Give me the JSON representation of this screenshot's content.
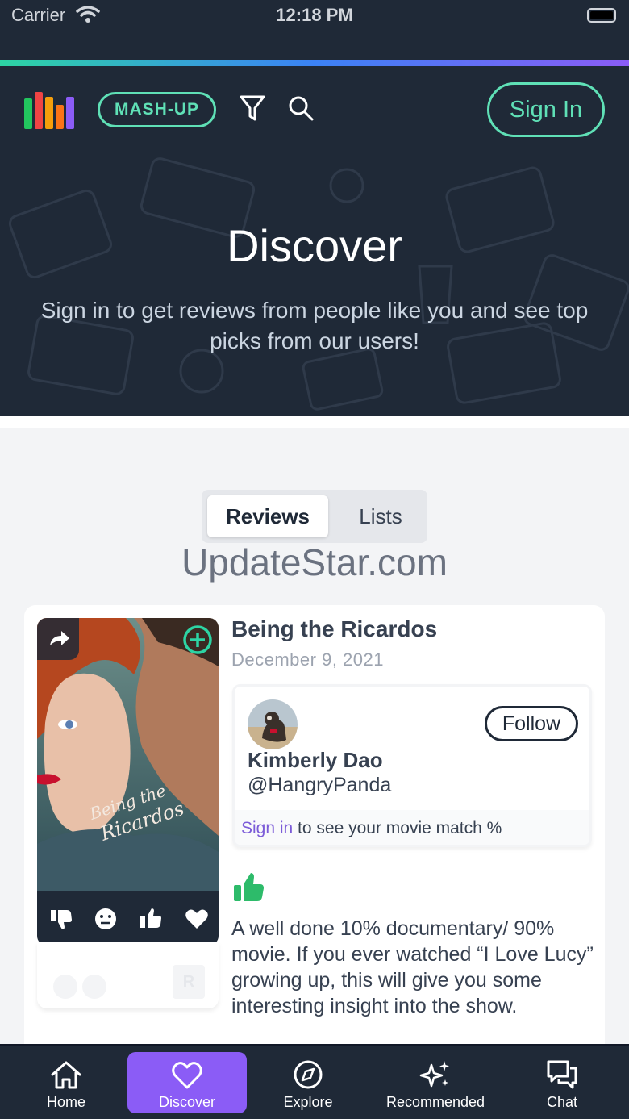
{
  "status_bar": {
    "carrier": "Carrier",
    "time": "12:18 PM"
  },
  "header": {
    "mashup_label": "MASH-UP",
    "signin_label": "Sign In",
    "logo_colors": [
      "#ef4444",
      "#22c55e",
      "#f59e0b",
      "#8b5cf6"
    ]
  },
  "hero": {
    "title": "Discover",
    "subtitle": "Sign in to get reviews from people like you and see top picks from our users!"
  },
  "tabs": {
    "active": "Reviews",
    "inactive": "Lists"
  },
  "watermark": "UpdateStar.com",
  "review_card": {
    "movie_title": "Being the Ricardos",
    "date": "December 9, 2021",
    "poster_script": "Being the Ricardos",
    "rating_badge": "R",
    "reviewer": {
      "name": "Kimberly Dao",
      "handle": "@HangryPanda",
      "follow_label": "Follow"
    },
    "match_link": "Sign in",
    "match_text": " to see your movie match %",
    "sentiment": "thumbs-up",
    "review_text": "A well done 10% documentary/ 90% movie. If you ever watched “I Love Lucy” growing up, this will give you some interesting insight into the show."
  },
  "bottom_nav": {
    "home": "Home",
    "discover": "Discover",
    "explore": "Explore",
    "recommended": "Recommended",
    "chat": "Chat"
  },
  "colors": {
    "accent": "#5fe0b6",
    "brand_purple": "#8b5cf6",
    "dark": "#1f2937"
  }
}
